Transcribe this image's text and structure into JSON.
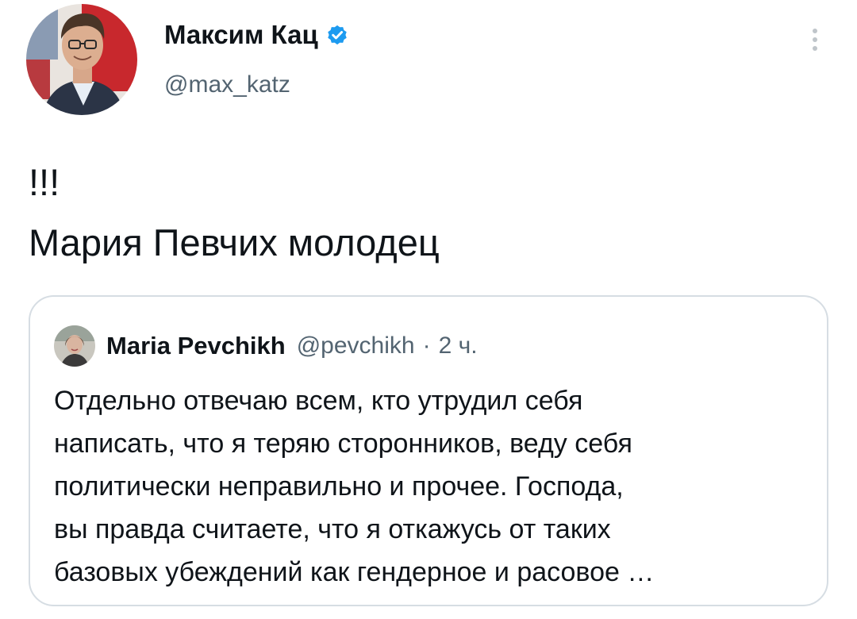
{
  "tweet": {
    "author": {
      "name": "Максим Кац",
      "handle": "@max_katz",
      "verified": true,
      "avatar_icon": "author-avatar-photo"
    },
    "text_lines": [
      "!!!",
      "Мария Певчих молодец"
    ],
    "more_icon": "more-vertical-icon"
  },
  "quoted_tweet": {
    "author": {
      "name": "Maria Pevchikh",
      "handle": "@pevchikh",
      "avatar_icon": "quoted-author-avatar-photo"
    },
    "separator": "·",
    "time": "2 ч.",
    "text_lines": [
      "Отдельно отвечаю всем, кто утрудил себя",
      "написать, что я теряю сторонников, веду себя",
      "политически неправильно и прочее. Господа,",
      "вы правда считаете, что я откажусь от таких",
      "базовых убеждений как гендерное и расовое …"
    ]
  },
  "colors": {
    "text": "#0f1419",
    "secondary_text": "#536471",
    "verified_badge": "#1d9bf0",
    "card_border": "#d6dde3"
  }
}
